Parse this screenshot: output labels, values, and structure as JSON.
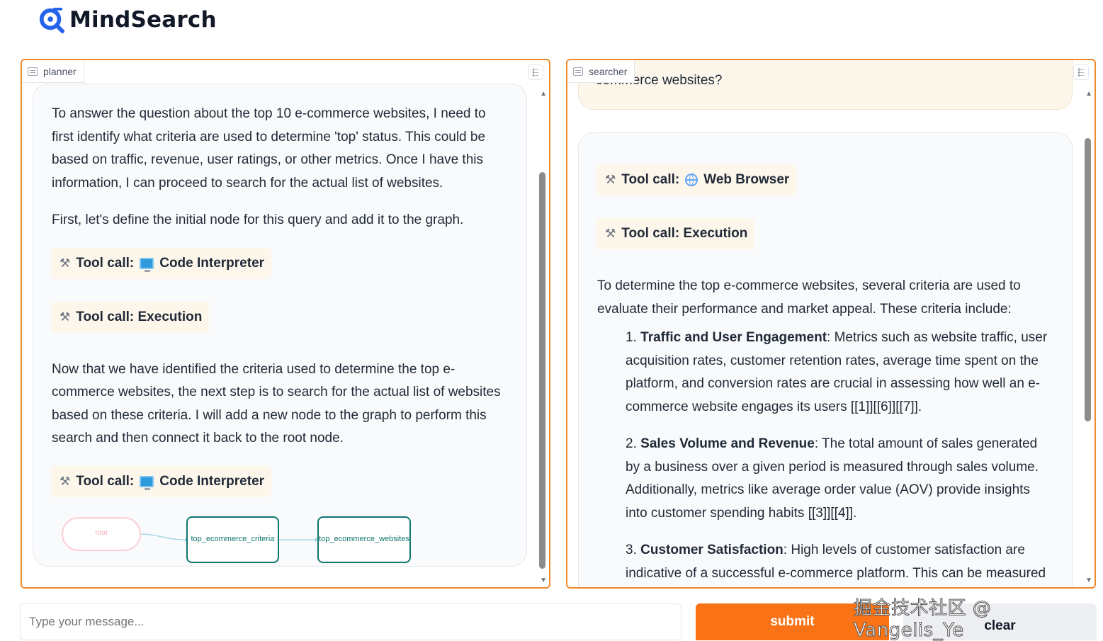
{
  "app": {
    "name": "MindSearch"
  },
  "planner": {
    "tab_label": "planner",
    "paragraphs": [
      "To answer the question about the top 10 e-commerce websites, I need to first identify what criteria are used to determine 'top' status. This could be based on traffic, revenue, user ratings, or other metrics. Once I have this information, I can proceed to search for the actual list of websites.",
      "First, let's define the initial node for this query and add it to the graph.",
      "Now that we have identified the criteria used to determine the top e-commerce websites, the next step is to search for the actual list of websites based on these criteria. I will add a new node to the graph to perform this search and then connect it back to the root node."
    ],
    "tool_calls": [
      {
        "prefix": "Tool call:",
        "name": "Code Interpreter",
        "icon": "monitor-icon"
      },
      {
        "prefix": "Tool call: Execution",
        "name": "",
        "icon": ""
      },
      {
        "prefix": "Tool call:",
        "name": "Code Interpreter",
        "icon": "monitor-icon"
      }
    ],
    "graph": {
      "nodes": [
        "root",
        "top_ecommerce_criteria",
        "top_ecommerce_websites"
      ]
    }
  },
  "searcher": {
    "tab_label": "searcher",
    "top_fragment": "commerce websites?",
    "tool_calls": [
      {
        "prefix": "Tool call:",
        "name": "Web Browser",
        "icon": "globe-icon"
      },
      {
        "prefix": "Tool call: Execution",
        "name": "",
        "icon": ""
      }
    ],
    "intro": "To determine the top e-commerce websites, several criteria are used to evaluate their performance and market appeal. These criteria include:",
    "items": [
      {
        "num": "1.",
        "title": "Traffic and User Engagement",
        "text": ": Metrics such as website traffic, user acquisition rates, customer retention rates, average time spent on the platform, and conversion rates are crucial in assessing how well an e-commerce website engages its users [[1]][[6]][[7]]."
      },
      {
        "num": "2.",
        "title": "Sales Volume and Revenue",
        "text": ": The total amount of sales generated by a business over a given period is measured through sales volume. Additionally, metrics like average order value (AOV) provide insights into customer spending habits [[3]][[4]]."
      },
      {
        "num": "3.",
        "title": "Customer Satisfaction",
        "text": ": High levels of customer satisfaction are indicative of a successful e-commerce platform. This can be measured through various means such as customer"
      }
    ]
  },
  "input": {
    "placeholder": "Type your message..."
  },
  "buttons": {
    "submit": "submit",
    "clear": "clear"
  },
  "watermark": "掘金技术社区 @ Vangelis_Ye",
  "colors": {
    "accent": "#f97316",
    "panel_border": "#f08a2c",
    "graph_node": "#0f766e",
    "root_node": "#fbcfd6"
  }
}
